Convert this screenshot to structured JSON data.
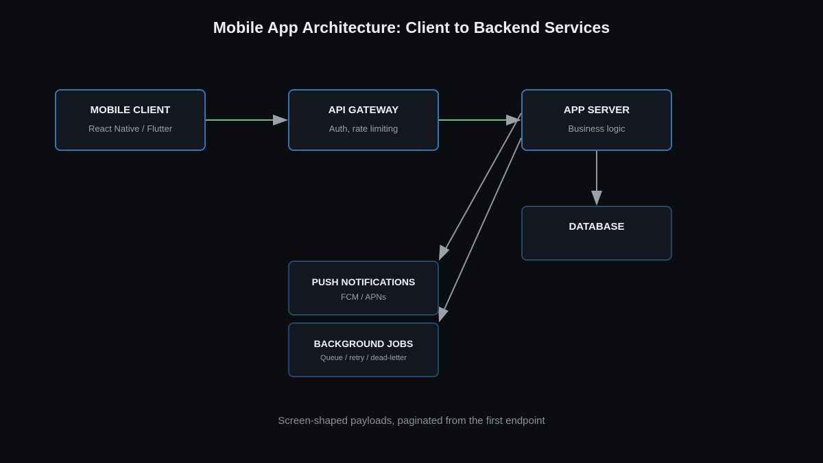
{
  "title": "Mobile App Architecture: Client to Backend Services",
  "caption": "Screen-shaped payloads, paginated from the first endpoint",
  "colors": {
    "background": "#0b0d11",
    "node_fill": "#121720",
    "node_border_primary": "#3677b3",
    "node_border_secondary": "#24486b",
    "edge_primary": "#6dba86",
    "edge_secondary": "#9097a1"
  },
  "nodes": {
    "mobile_client": {
      "title": "MOBILE CLIENT",
      "subtitle": "React Native / Flutter"
    },
    "api_gateway": {
      "title": "API GATEWAY",
      "subtitle": "Auth, rate limiting"
    },
    "app_server": {
      "title": "APP SERVER",
      "subtitle": "Business logic"
    },
    "database": {
      "title": "DATABASE"
    },
    "push_notifications": {
      "title": "PUSH NOTIFICATIONS",
      "subtitle": "FCM / APNs"
    },
    "background_jobs": {
      "title": "BACKGROUND JOBS",
      "subtitle": "Queue / retry / dead-letter"
    }
  },
  "edges": [
    {
      "from": "mobile_client",
      "to": "api_gateway",
      "style": "primary"
    },
    {
      "from": "api_gateway",
      "to": "app_server",
      "style": "primary"
    },
    {
      "from": "app_server",
      "to": "database",
      "style": "secondary"
    },
    {
      "from": "app_server",
      "to": "push_notifications",
      "style": "secondary"
    },
    {
      "from": "app_server",
      "to": "background_jobs",
      "style": "secondary"
    }
  ]
}
